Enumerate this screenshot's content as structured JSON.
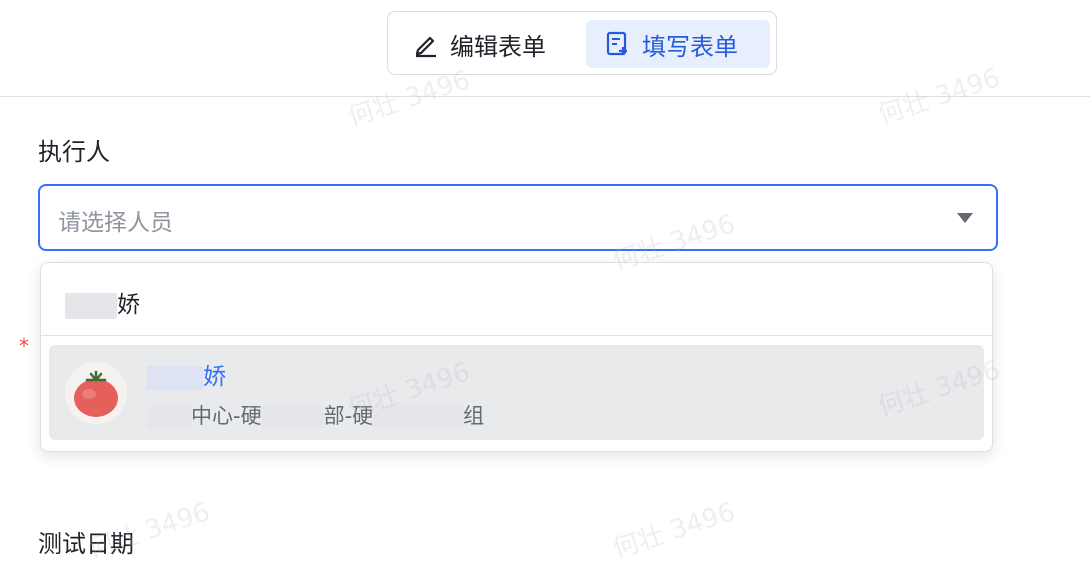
{
  "mode_switch": {
    "edit_label": "编辑表单",
    "fill_label": "填写表单"
  },
  "form": {
    "executor_label": "执行人",
    "select_placeholder": "请选择人员",
    "required_mark": "*",
    "next_field_label": "测试日期"
  },
  "dropdown": {
    "search_value_suffix": "娇",
    "option": {
      "name_suffix": "娇",
      "dept_part1": "中心-硬",
      "dept_part2": "部-硬",
      "dept_part3": "组"
    }
  },
  "watermark": "何壮 3496",
  "colors": {
    "accent": "#3370ff",
    "selected_bg": "#e8effc",
    "option_hover_bg": "#e9eaec",
    "required": "#f54a45"
  },
  "icons": {
    "edit": "pencil-icon",
    "fill": "form-fill-icon",
    "caret": "caret-down-icon",
    "avatar": "tomato-avatar"
  }
}
